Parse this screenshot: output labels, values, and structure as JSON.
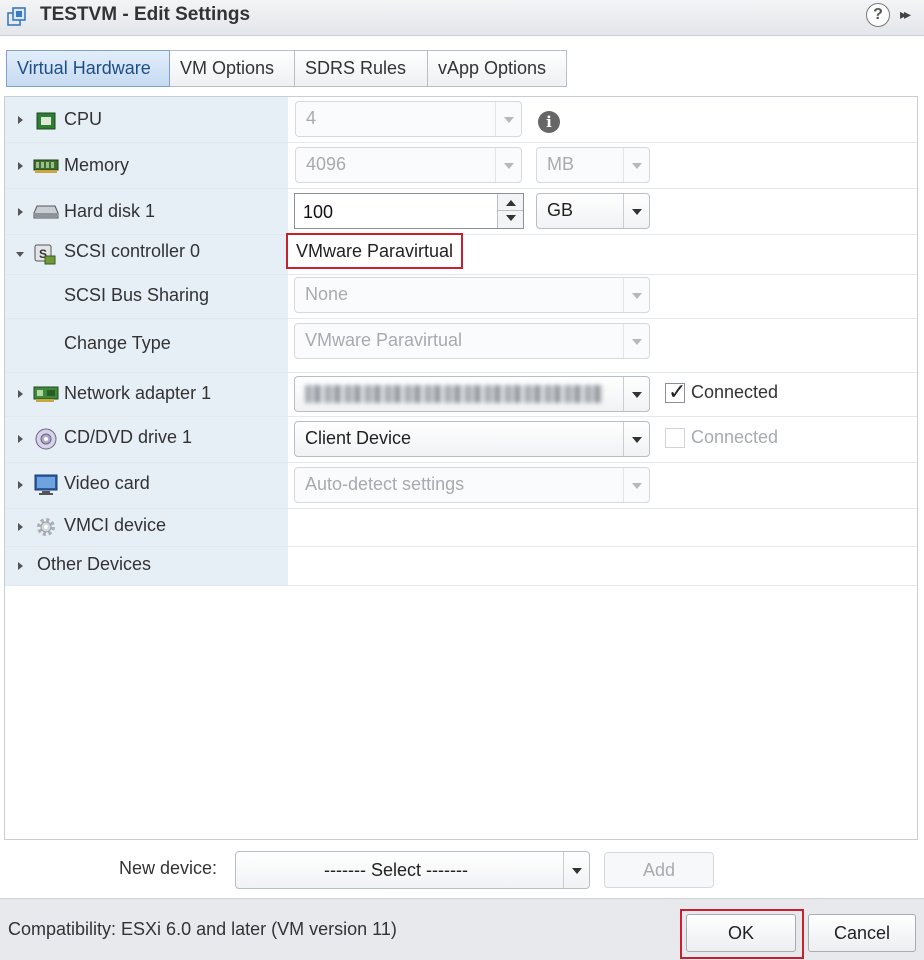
{
  "window": {
    "title": "TESTVM - Edit Settings",
    "help_glyph": "?",
    "more_glyph": "▸▸"
  },
  "tabs": [
    {
      "label": "Virtual Hardware",
      "active": true
    },
    {
      "label": "VM Options"
    },
    {
      "label": "SDRS Rules"
    },
    {
      "label": "vApp Options"
    }
  ],
  "hardware": {
    "cpu": {
      "label": "CPU",
      "value": "4",
      "info_glyph": "i"
    },
    "memory": {
      "label": "Memory",
      "value": "4096",
      "unit": "MB"
    },
    "hard_disk": {
      "label": "Hard disk 1",
      "value": "100",
      "unit": "GB"
    },
    "scsi": {
      "label": "SCSI controller 0",
      "value": "VMware Paravirtual"
    },
    "scsi_bus_sharing": {
      "label": "SCSI Bus Sharing",
      "value": "None"
    },
    "change_type": {
      "label": "Change Type",
      "value": "VMware Paravirtual"
    },
    "network": {
      "label": "Network adapter 1",
      "connected_label": "Connected",
      "connected": true
    },
    "cddvd": {
      "label": "CD/DVD drive 1",
      "value": "Client Device",
      "connected_label": "Connected",
      "connected": false
    },
    "video": {
      "label": "Video card",
      "value": "Auto-detect settings"
    },
    "vmci": {
      "label": "VMCI device"
    },
    "other": {
      "label": "Other Devices"
    }
  },
  "new_device": {
    "label": "New device:",
    "select_value": "------- Select -------",
    "add_label": "Add"
  },
  "footer": {
    "compatibility": "Compatibility: ESXi 6.0 and later (VM version 11)",
    "ok_label": "OK",
    "cancel_label": "Cancel"
  },
  "colors": {
    "highlight": "#c8202f",
    "active_tab": "#c5daf1",
    "label_column": "#e6eef6"
  }
}
